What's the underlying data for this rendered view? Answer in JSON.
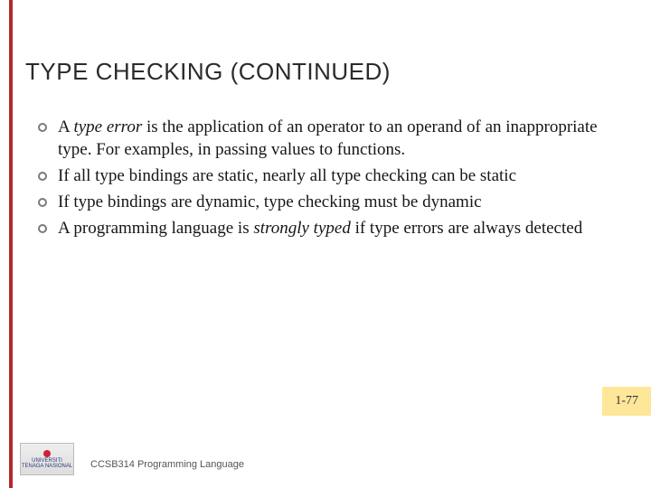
{
  "colors": {
    "accent": "#b0292e",
    "badge_bg": "#ffe79a"
  },
  "title": "TYPE CHECKING (CONTINUED)",
  "bullets": [
    {
      "pre": "A ",
      "em": "type error",
      "post": " is the application of an operator to an operand of an inappropriate type.  For examples, in passing values to functions."
    },
    {
      "pre": "If all type bindings are static, nearly all type checking can be static",
      "em": "",
      "post": ""
    },
    {
      "pre": "If type bindings are dynamic, type checking must be dynamic",
      "em": "",
      "post": ""
    },
    {
      "pre": "A programming language is ",
      "em": "strongly typed",
      "post": " if type errors are always detected"
    }
  ],
  "page_number": "1-77",
  "footer": {
    "logo_text": "UNIVERSITI TENAGA NASIONAL",
    "course": "CCSB314 Programming Language"
  }
}
